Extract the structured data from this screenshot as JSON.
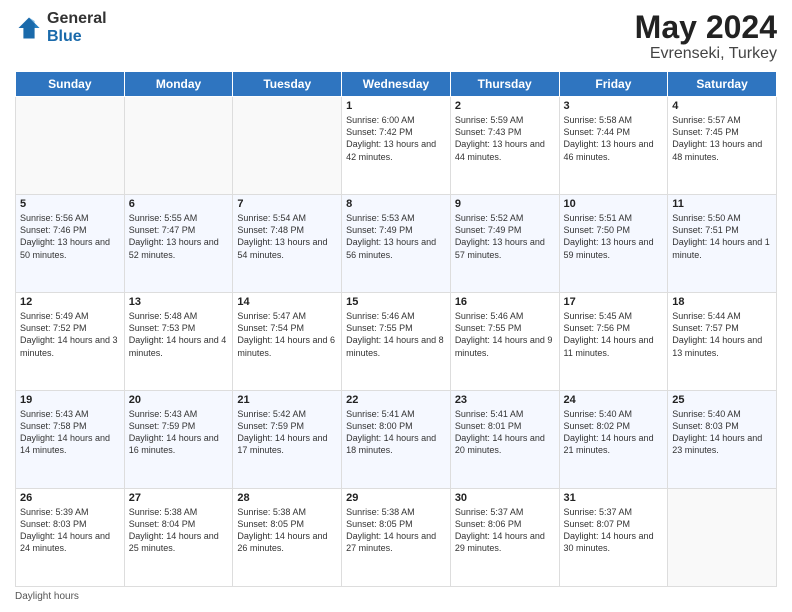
{
  "logo": {
    "general": "General",
    "blue": "Blue"
  },
  "title": {
    "month_year": "May 2024",
    "location": "Evrenseki, Turkey"
  },
  "days_of_week": [
    "Sunday",
    "Monday",
    "Tuesday",
    "Wednesday",
    "Thursday",
    "Friday",
    "Saturday"
  ],
  "footer": {
    "daylight_hours": "Daylight hours"
  },
  "weeks": [
    [
      {
        "day": "",
        "sunrise": "",
        "sunset": "",
        "daylight": ""
      },
      {
        "day": "",
        "sunrise": "",
        "sunset": "",
        "daylight": ""
      },
      {
        "day": "",
        "sunrise": "",
        "sunset": "",
        "daylight": ""
      },
      {
        "day": "1",
        "sunrise": "Sunrise: 6:00 AM",
        "sunset": "Sunset: 7:42 PM",
        "daylight": "Daylight: 13 hours and 42 minutes."
      },
      {
        "day": "2",
        "sunrise": "Sunrise: 5:59 AM",
        "sunset": "Sunset: 7:43 PM",
        "daylight": "Daylight: 13 hours and 44 minutes."
      },
      {
        "day": "3",
        "sunrise": "Sunrise: 5:58 AM",
        "sunset": "Sunset: 7:44 PM",
        "daylight": "Daylight: 13 hours and 46 minutes."
      },
      {
        "day": "4",
        "sunrise": "Sunrise: 5:57 AM",
        "sunset": "Sunset: 7:45 PM",
        "daylight": "Daylight: 13 hours and 48 minutes."
      }
    ],
    [
      {
        "day": "5",
        "sunrise": "Sunrise: 5:56 AM",
        "sunset": "Sunset: 7:46 PM",
        "daylight": "Daylight: 13 hours and 50 minutes."
      },
      {
        "day": "6",
        "sunrise": "Sunrise: 5:55 AM",
        "sunset": "Sunset: 7:47 PM",
        "daylight": "Daylight: 13 hours and 52 minutes."
      },
      {
        "day": "7",
        "sunrise": "Sunrise: 5:54 AM",
        "sunset": "Sunset: 7:48 PM",
        "daylight": "Daylight: 13 hours and 54 minutes."
      },
      {
        "day": "8",
        "sunrise": "Sunrise: 5:53 AM",
        "sunset": "Sunset: 7:49 PM",
        "daylight": "Daylight: 13 hours and 56 minutes."
      },
      {
        "day": "9",
        "sunrise": "Sunrise: 5:52 AM",
        "sunset": "Sunset: 7:49 PM",
        "daylight": "Daylight: 13 hours and 57 minutes."
      },
      {
        "day": "10",
        "sunrise": "Sunrise: 5:51 AM",
        "sunset": "Sunset: 7:50 PM",
        "daylight": "Daylight: 13 hours and 59 minutes."
      },
      {
        "day": "11",
        "sunrise": "Sunrise: 5:50 AM",
        "sunset": "Sunset: 7:51 PM",
        "daylight": "Daylight: 14 hours and 1 minute."
      }
    ],
    [
      {
        "day": "12",
        "sunrise": "Sunrise: 5:49 AM",
        "sunset": "Sunset: 7:52 PM",
        "daylight": "Daylight: 14 hours and 3 minutes."
      },
      {
        "day": "13",
        "sunrise": "Sunrise: 5:48 AM",
        "sunset": "Sunset: 7:53 PM",
        "daylight": "Daylight: 14 hours and 4 minutes."
      },
      {
        "day": "14",
        "sunrise": "Sunrise: 5:47 AM",
        "sunset": "Sunset: 7:54 PM",
        "daylight": "Daylight: 14 hours and 6 minutes."
      },
      {
        "day": "15",
        "sunrise": "Sunrise: 5:46 AM",
        "sunset": "Sunset: 7:55 PM",
        "daylight": "Daylight: 14 hours and 8 minutes."
      },
      {
        "day": "16",
        "sunrise": "Sunrise: 5:46 AM",
        "sunset": "Sunset: 7:55 PM",
        "daylight": "Daylight: 14 hours and 9 minutes."
      },
      {
        "day": "17",
        "sunrise": "Sunrise: 5:45 AM",
        "sunset": "Sunset: 7:56 PM",
        "daylight": "Daylight: 14 hours and 11 minutes."
      },
      {
        "day": "18",
        "sunrise": "Sunrise: 5:44 AM",
        "sunset": "Sunset: 7:57 PM",
        "daylight": "Daylight: 14 hours and 13 minutes."
      }
    ],
    [
      {
        "day": "19",
        "sunrise": "Sunrise: 5:43 AM",
        "sunset": "Sunset: 7:58 PM",
        "daylight": "Daylight: 14 hours and 14 minutes."
      },
      {
        "day": "20",
        "sunrise": "Sunrise: 5:43 AM",
        "sunset": "Sunset: 7:59 PM",
        "daylight": "Daylight: 14 hours and 16 minutes."
      },
      {
        "day": "21",
        "sunrise": "Sunrise: 5:42 AM",
        "sunset": "Sunset: 7:59 PM",
        "daylight": "Daylight: 14 hours and 17 minutes."
      },
      {
        "day": "22",
        "sunrise": "Sunrise: 5:41 AM",
        "sunset": "Sunset: 8:00 PM",
        "daylight": "Daylight: 14 hours and 18 minutes."
      },
      {
        "day": "23",
        "sunrise": "Sunrise: 5:41 AM",
        "sunset": "Sunset: 8:01 PM",
        "daylight": "Daylight: 14 hours and 20 minutes."
      },
      {
        "day": "24",
        "sunrise": "Sunrise: 5:40 AM",
        "sunset": "Sunset: 8:02 PM",
        "daylight": "Daylight: 14 hours and 21 minutes."
      },
      {
        "day": "25",
        "sunrise": "Sunrise: 5:40 AM",
        "sunset": "Sunset: 8:03 PM",
        "daylight": "Daylight: 14 hours and 23 minutes."
      }
    ],
    [
      {
        "day": "26",
        "sunrise": "Sunrise: 5:39 AM",
        "sunset": "Sunset: 8:03 PM",
        "daylight": "Daylight: 14 hours and 24 minutes."
      },
      {
        "day": "27",
        "sunrise": "Sunrise: 5:38 AM",
        "sunset": "Sunset: 8:04 PM",
        "daylight": "Daylight: 14 hours and 25 minutes."
      },
      {
        "day": "28",
        "sunrise": "Sunrise: 5:38 AM",
        "sunset": "Sunset: 8:05 PM",
        "daylight": "Daylight: 14 hours and 26 minutes."
      },
      {
        "day": "29",
        "sunrise": "Sunrise: 5:38 AM",
        "sunset": "Sunset: 8:05 PM",
        "daylight": "Daylight: 14 hours and 27 minutes."
      },
      {
        "day": "30",
        "sunrise": "Sunrise: 5:37 AM",
        "sunset": "Sunset: 8:06 PM",
        "daylight": "Daylight: 14 hours and 29 minutes."
      },
      {
        "day": "31",
        "sunrise": "Sunrise: 5:37 AM",
        "sunset": "Sunset: 8:07 PM",
        "daylight": "Daylight: 14 hours and 30 minutes."
      },
      {
        "day": "",
        "sunrise": "",
        "sunset": "",
        "daylight": ""
      }
    ]
  ]
}
